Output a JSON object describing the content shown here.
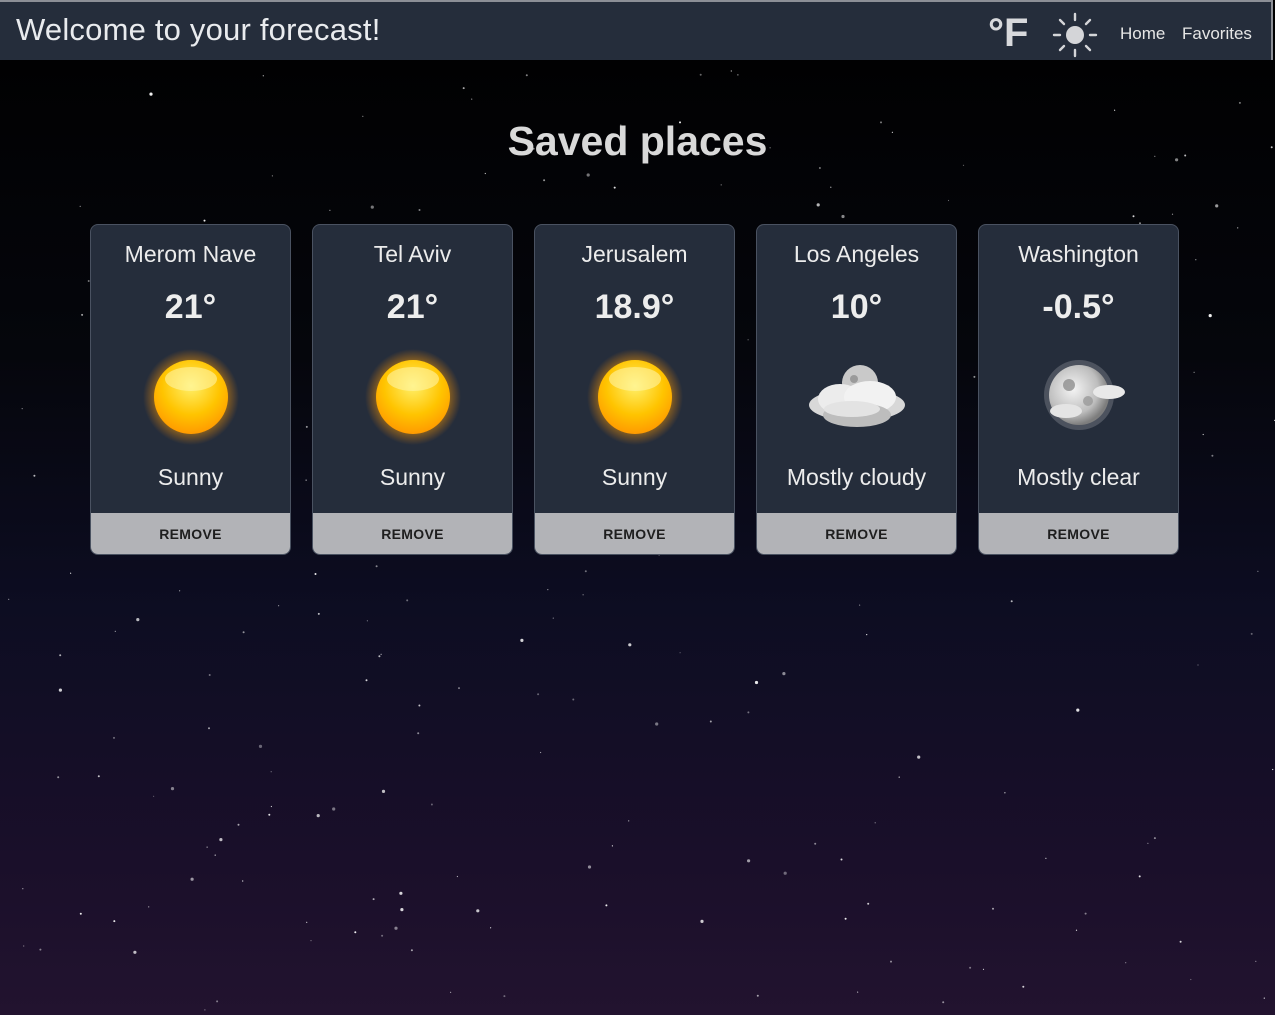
{
  "header": {
    "title": "Welcome to your forecast!",
    "unit_toggle_label": "°F",
    "theme_icon": "sun-icon",
    "nav": [
      {
        "label": "Home"
      },
      {
        "label": "Favorites"
      }
    ]
  },
  "main": {
    "title": "Saved places",
    "remove_label": "REMOVE",
    "cards": [
      {
        "city": "Merom Nave",
        "temperature": "21°",
        "condition": "Sunny",
        "icon": "sun-icon"
      },
      {
        "city": "Tel Aviv",
        "temperature": "21°",
        "condition": "Sunny",
        "icon": "sun-icon"
      },
      {
        "city": "Jerusalem",
        "temperature": "18.9°",
        "condition": "Sunny",
        "icon": "sun-icon"
      },
      {
        "city": "Los Angeles",
        "temperature": "10°",
        "condition": "Mostly cloudy",
        "icon": "night-cloud-icon"
      },
      {
        "city": "Washington",
        "temperature": "-0.5°",
        "condition": "Mostly clear",
        "icon": "moon-cloud-icon"
      }
    ]
  },
  "colors": {
    "header_bg": "#252d3b",
    "card_bg": "#252d3b",
    "button_bg": "#b2b3b7",
    "sun_core": "#ffc400",
    "sun_glow": "#ffb000"
  }
}
